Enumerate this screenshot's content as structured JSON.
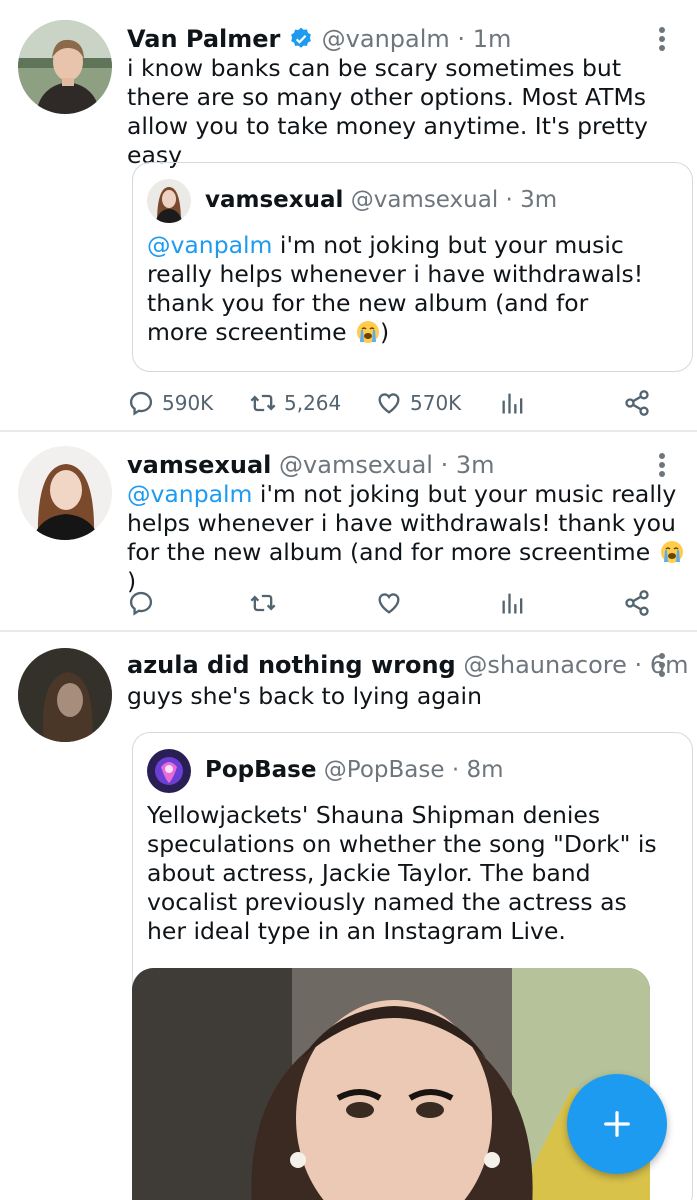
{
  "tweets": [
    {
      "name": "Van Palmer",
      "verified": true,
      "handle": "@vanpalm",
      "separator": "·",
      "time": "1m",
      "body": "i know banks can be scary sometimes but there are so many other options. Most ATMs allow you to take money anytime. It's pretty easy",
      "quote": {
        "name": "vamsexual",
        "handle": "@vamsexual",
        "separator": "·",
        "time": "3m",
        "mention": "@vanpalm",
        "body": " i'm not joking but your music really helps whenever i have withdrawals! thank you for the new album (and for more screentime ",
        "emoji": "loudly-crying-face",
        "body_end": ")"
      },
      "stats": {
        "replies": "590K",
        "retweets": "5,264",
        "likes": "570K"
      }
    },
    {
      "name": "vamsexual",
      "handle": "@vamsexual",
      "separator": "·",
      "time": "3m",
      "mention": "@vanpalm",
      "body": " i'm not joking but your music really helps whenever i have withdrawals! thank you for the new album (and for more screentime ",
      "emoji": "loudly-crying-face",
      "body_end": ")"
    },
    {
      "name": "azula did nothing wrong",
      "handle": "@shaunacore",
      "separator": "·",
      "time": "6m",
      "body": "guys she's back to lying again",
      "quote": {
        "name": "PopBase",
        "handle": "@PopBase",
        "separator": "·",
        "time": "8m",
        "body": "Yellowjackets' Shauna Shipman denies speculations on whether the song \"Dork\" is about actress, Jackie Taylor. The band vocalist previously named the actress as her ideal type in an Instagram Live."
      }
    }
  ],
  "colors": {
    "accent": "#1d9bf0",
    "muted": "#6e767d",
    "divider": "#e7e9eb"
  },
  "compose_button": {
    "icon": "plus-icon"
  }
}
